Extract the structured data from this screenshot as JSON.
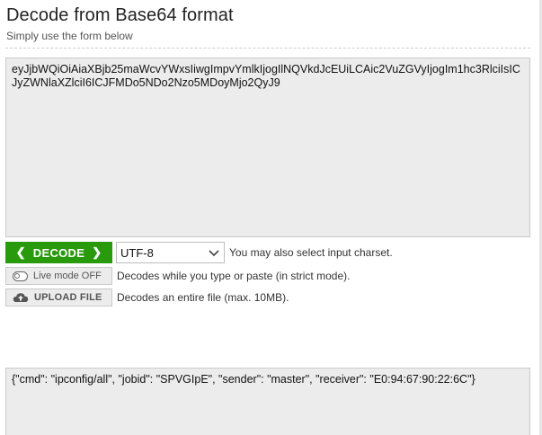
{
  "header": {
    "title": "Decode from Base64 format",
    "subtitle": "Simply use the form below"
  },
  "input": {
    "value": "eyJjbWQiOiAiaXBjb25maWcvYWxsIiwgImpvYmlkIjogIlNQVkdJcEUiLCAic2VuZGVyIjogIm1hc3RlciIsICJyZWNlaXZlciI6ICJFMDo5NDo2Nzo5MDoyMjo2QyJ9"
  },
  "controls": {
    "decode_label": "DECODE",
    "charset_selected": "UTF-8",
    "charset_hint": "You may also select input charset.",
    "live_mode_label": "Live mode OFF",
    "live_mode_hint": "Decodes while you type or paste (in strict mode).",
    "upload_label": "UPLOAD FILE",
    "upload_hint": "Decodes an entire file (max. 10MB)."
  },
  "output": {
    "value": "{\"cmd\": \"ipconfig/all\", \"jobid\": \"SPVGIpE\", \"sender\": \"master\", \"receiver\": \"E0:94:67:90:22:6C\"}"
  },
  "icons": {
    "decode_left": "chevron-left-icon",
    "decode_right": "chevron-right-icon",
    "select_arrow": "chevron-down-icon",
    "live_mode": "toggle-off-icon",
    "upload": "cloud-upload-icon"
  },
  "colors": {
    "decode_button": "#2a9a0d",
    "textarea_bg": "#ececec"
  }
}
